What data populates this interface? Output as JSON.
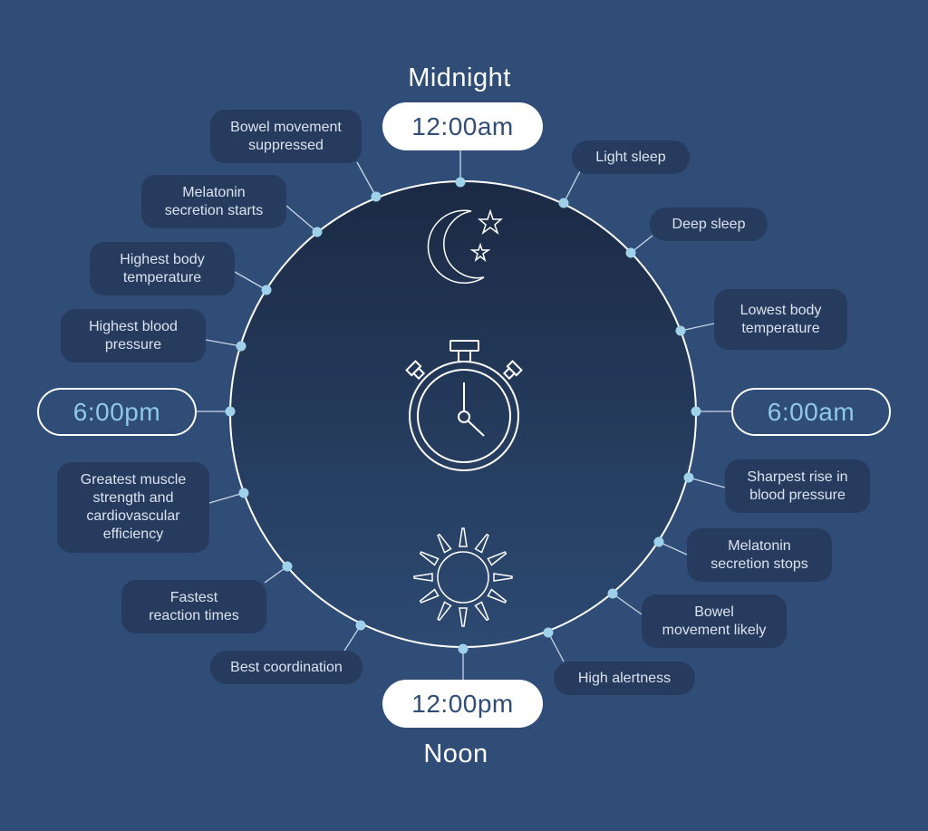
{
  "title_top": "Midnight",
  "title_bottom": "Noon",
  "colors": {
    "background": "#2f4d76",
    "label_bg": "#263b5e",
    "label_text": "#dbe3ee",
    "dot": "#9fd2ea",
    "accent_time": "#8fc9e6",
    "circle_top": "#1b2a44",
    "circle_bottom": "#2c4870"
  },
  "icons": {
    "top": "moon-stars-icon",
    "center": "stopwatch-icon",
    "bottom": "sun-icon"
  },
  "time_markers": [
    {
      "id": "midnight",
      "label": "12:00am",
      "style": "white"
    },
    {
      "id": "six-am",
      "label": "6:00am",
      "style": "outline"
    },
    {
      "id": "noon",
      "label": "12:00pm",
      "style": "white"
    },
    {
      "id": "six-pm",
      "label": "6:00pm",
      "style": "outline"
    }
  ],
  "events": [
    {
      "label": "Light sleep"
    },
    {
      "label": "Deep sleep"
    },
    {
      "label": "Lowest body\ntemperature"
    },
    {
      "label": "Sharpest rise in\nblood pressure"
    },
    {
      "label": "Melatonin\nsecretion stops"
    },
    {
      "label": "Bowel\nmovement likely"
    },
    {
      "label": "High alertness"
    },
    {
      "label": "Best coordination"
    },
    {
      "label": "Fastest\nreaction times"
    },
    {
      "label": "Greatest muscle\nstrength and\ncardiovascular\nefficiency"
    },
    {
      "label": "Highest blood\npressure"
    },
    {
      "label": "Highest body\ntemperature"
    },
    {
      "label": "Melatonin\nsecretion starts"
    },
    {
      "label": "Bowel movement\nsuppressed"
    }
  ]
}
